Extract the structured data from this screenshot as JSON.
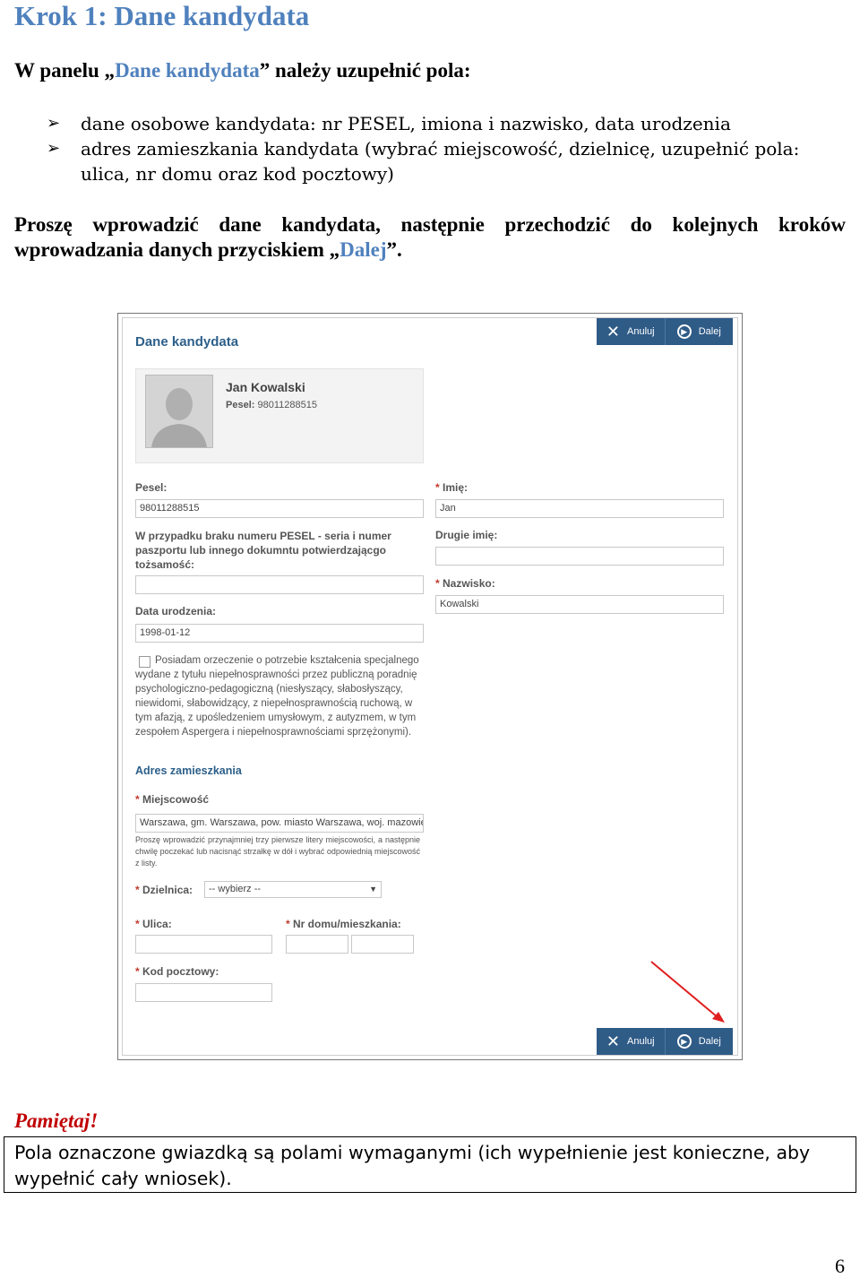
{
  "heading": "Krok 1: Dane kandydata",
  "intro": {
    "prefix": "W panelu „",
    "link": "Dane kandydata",
    "suffix": "” należy uzupełnić pola:"
  },
  "bullets": [
    "dane osobowe kandydata: nr PESEL, imiona i nazwisko, data urodzenia",
    "adres zamieszkania kandydata (wybrać miejscowość, dzielnicę, uzupełnić pola: ulica, nr domu oraz kod pocztowy)"
  ],
  "instruction": {
    "line1": "Proszę wprowadzić dane kandydata, następnie przechodzić do kolejnych kroków",
    "line2_prefix": "wprowadzania danych przyciskiem „",
    "button_name": "Dalej",
    "line2_suffix": "”."
  },
  "form": {
    "title": "Dane kandydata",
    "cancel_label": "Anuluj",
    "next_label": "Dalej",
    "profile_name": "Jan Kowalski",
    "profile_pesel_label": "Pesel:",
    "profile_pesel_value": "98011288515",
    "pesel_label": "Pesel:",
    "pesel_value": "98011288515",
    "passport_label": "W przypadku braku numeru PESEL - seria i numer paszportu lub innego dokumntu potwierdzającgo tożsamość:",
    "passport_value": "",
    "birth_label": "Data urodzenia:",
    "birth_value": "1998-01-12",
    "disability_checkbox_label": "Posiadam orzeczenie o potrzebie kształcenia specjalnego wydane z tytułu niepełnosprawności przez publiczną poradnię psychologiczno-pedagogiczną (niesłyszący, słabosłyszący, niewidomi, słabowidzący, z niepełnosprawnością ruchową, w tym afazją, z upośledzeniem umysłowym, z autyzmem, w tym zespołem Aspergera i niepełnosprawnościami sprzężonymi).",
    "first_name_label": "Imię:",
    "first_name_value": "Jan",
    "second_name_label": "Drugie imię:",
    "second_name_value": "",
    "last_name_label": "Nazwisko:",
    "last_name_value": "Kowalski",
    "address_section": "Adres zamieszkania",
    "city_label": "Miejscowość",
    "city_value": "Warszawa, gm. Warszawa, pow. miasto Warszawa, woj. mazowie",
    "city_hint": "Proszę wprowadzić przynajmniej trzy pierwsze litery miejscowości, a następnie chwilę poczekać lub nacisnąć strzałkę w dół i wybrać odpowiednią miejscowość z listy.",
    "district_label": "Dzielnica:",
    "district_value": "-- wybierz --",
    "street_label": "Ulica:",
    "street_value": "",
    "house_label": "Nr domu/mieszkania:",
    "house_value": "",
    "flat_value": "",
    "postal_label": "Kod pocztowy:",
    "postal_value": "",
    "required_mark": "*"
  },
  "note": {
    "title": "Pamiętaj!",
    "text": "Pola oznaczone gwiazdką są polami wymaganymi (ich wypełnienie jest konieczne, aby wypełnić cały wniosek)."
  },
  "page_number": "6",
  "colors": {
    "heading": "#4f81bd",
    "button_bar": "#2f5b87",
    "note_title": "#c00000",
    "arrow": "#e02020"
  },
  "icons": [
    "bullet-arrow-icon",
    "cancel-x-icon",
    "next-circle-icon",
    "avatar-icon",
    "dropdown-caret-icon",
    "red-pointer-arrow"
  ]
}
